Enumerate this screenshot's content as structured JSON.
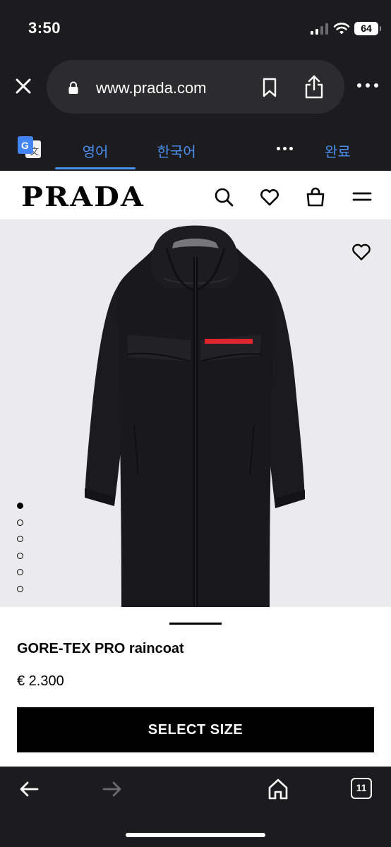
{
  "status_bar": {
    "time": "3:50",
    "battery_level": "64",
    "icons": [
      "cellular-signal-icon",
      "wifi-icon",
      "battery-icon"
    ]
  },
  "browser": {
    "url": "www.prada.com",
    "icons": [
      "close-icon",
      "lock-icon",
      "bookmark-icon",
      "share-icon",
      "more-icon"
    ]
  },
  "translate_bar": {
    "source_language": "영어",
    "target_language": "한국어",
    "done_label": "완료",
    "icons": [
      "google-translate-icon",
      "more-icon"
    ]
  },
  "site": {
    "logo": "PRADA",
    "header_icons": [
      "search-icon",
      "heart-icon",
      "shopping-bag-icon",
      "menu-icon"
    ]
  },
  "gallery": {
    "image_count": 6,
    "active_index": 0,
    "wishlist_icon": "heart-icon"
  },
  "product": {
    "name": "GORE-TEX PRO raincoat",
    "price": "€ 2.300",
    "cta_label": "SELECT SIZE"
  },
  "bottom_toolbar": {
    "tab_count": "11",
    "back_enabled": true,
    "forward_enabled": false,
    "icons": [
      "back-arrow-icon",
      "forward-arrow-icon",
      "home-icon",
      "tabs-icon"
    ]
  },
  "colors": {
    "chrome_bg": "#1c1c1e",
    "accent_blue": "#4a90f0",
    "brand_black": "#000000",
    "stripe_red": "#e0262c"
  }
}
